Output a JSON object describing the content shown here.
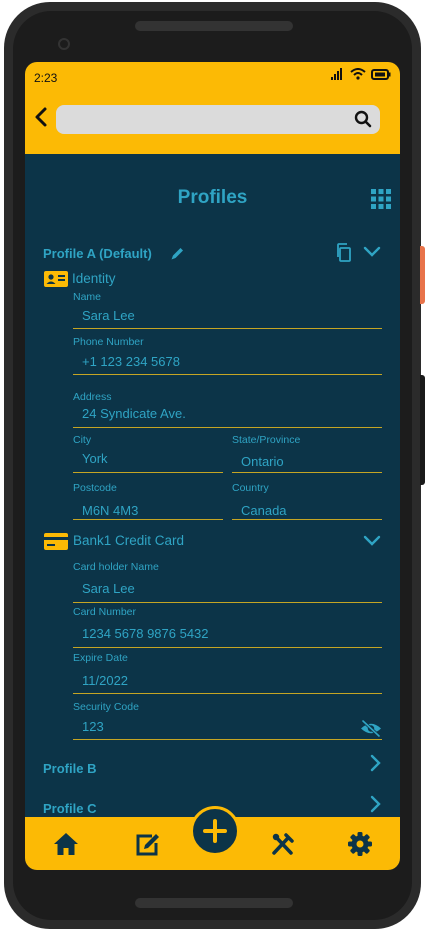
{
  "status": {
    "time": "2:23"
  },
  "search": {
    "placeholder": "",
    "value": ""
  },
  "page": {
    "title": "Profiles"
  },
  "profiles": {
    "a": {
      "title": "Profile A (Default)",
      "identity": {
        "title": "Identity",
        "name_label": "Name",
        "name_value": "Sara Lee",
        "phone_label": "Phone Number",
        "phone_value": "+1 123 234 5678",
        "address_label": "Address",
        "address_value": "24 Syndicate Ave.",
        "city_label": "City",
        "city_value": "York",
        "state_label": "State/Province",
        "state_value": "Ontario",
        "postcode_label": "Postcode",
        "postcode_value": "M6N 4M3",
        "country_label": "Country",
        "country_value": "Canada"
      },
      "card": {
        "title": "Bank1 Credit Card",
        "holder_label": "Card holder Name",
        "holder_value": "Sara Lee",
        "number_label": "Card Number",
        "number_value": "1234 5678 9876 5432",
        "expire_label": "Expire Date",
        "expire_value": "11/2022",
        "security_label": "Security Code",
        "security_value": "123"
      }
    },
    "b": {
      "title": "Profile B"
    },
    "c": {
      "title": "Profile C"
    }
  },
  "nav": {
    "items": [
      "home-icon",
      "edit-icon",
      "add-icon",
      "tools-icon",
      "gear-icon"
    ]
  },
  "colors": {
    "accent": "#fcba05",
    "background": "#0c3448",
    "text": "#2fa4c4",
    "line": "#c5a524"
  }
}
